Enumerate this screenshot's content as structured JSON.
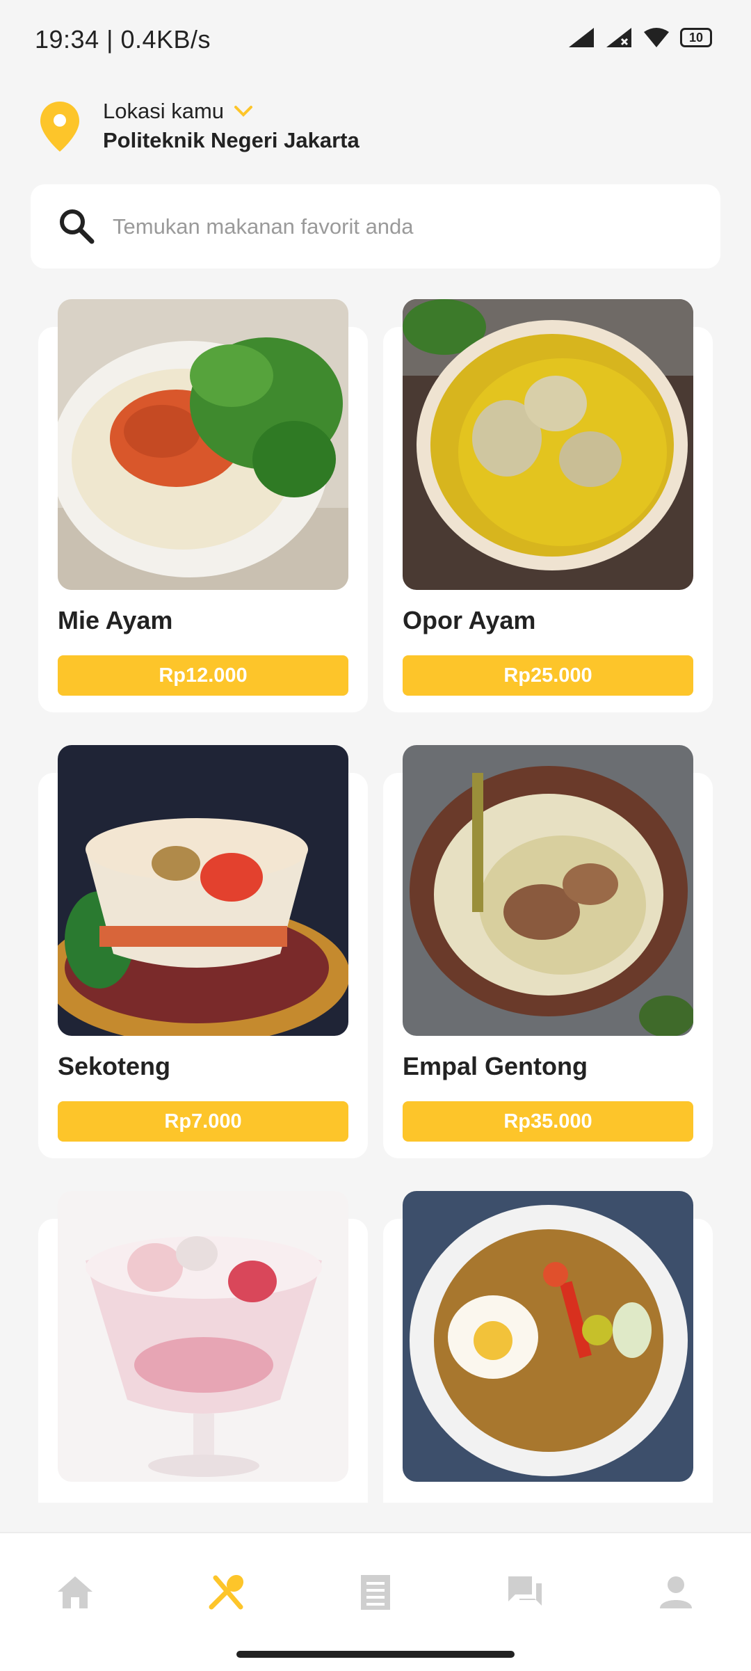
{
  "status": {
    "time": "19:34 | 0.4KB/s",
    "battery": "10"
  },
  "location": {
    "label": "Lokasi kamu",
    "name": "Politeknik Negeri Jakarta"
  },
  "search": {
    "placeholder": "Temukan makanan favorit anda"
  },
  "foods": [
    {
      "name": "Mie Ayam",
      "price": "Rp12.000"
    },
    {
      "name": "Opor Ayam",
      "price": "Rp25.000"
    },
    {
      "name": "Sekoteng",
      "price": "Rp7.000"
    },
    {
      "name": "Empal Gentong",
      "price": "Rp35.000"
    },
    {
      "name": "",
      "price": ""
    },
    {
      "name": "",
      "price": ""
    }
  ],
  "nav": {
    "active": "menu",
    "items": [
      "home-icon",
      "menu-icon",
      "orders-icon",
      "chat-icon",
      "profile-icon"
    ]
  },
  "colors": {
    "accent": "#fdc52a",
    "inactive": "#cfcfcf"
  }
}
